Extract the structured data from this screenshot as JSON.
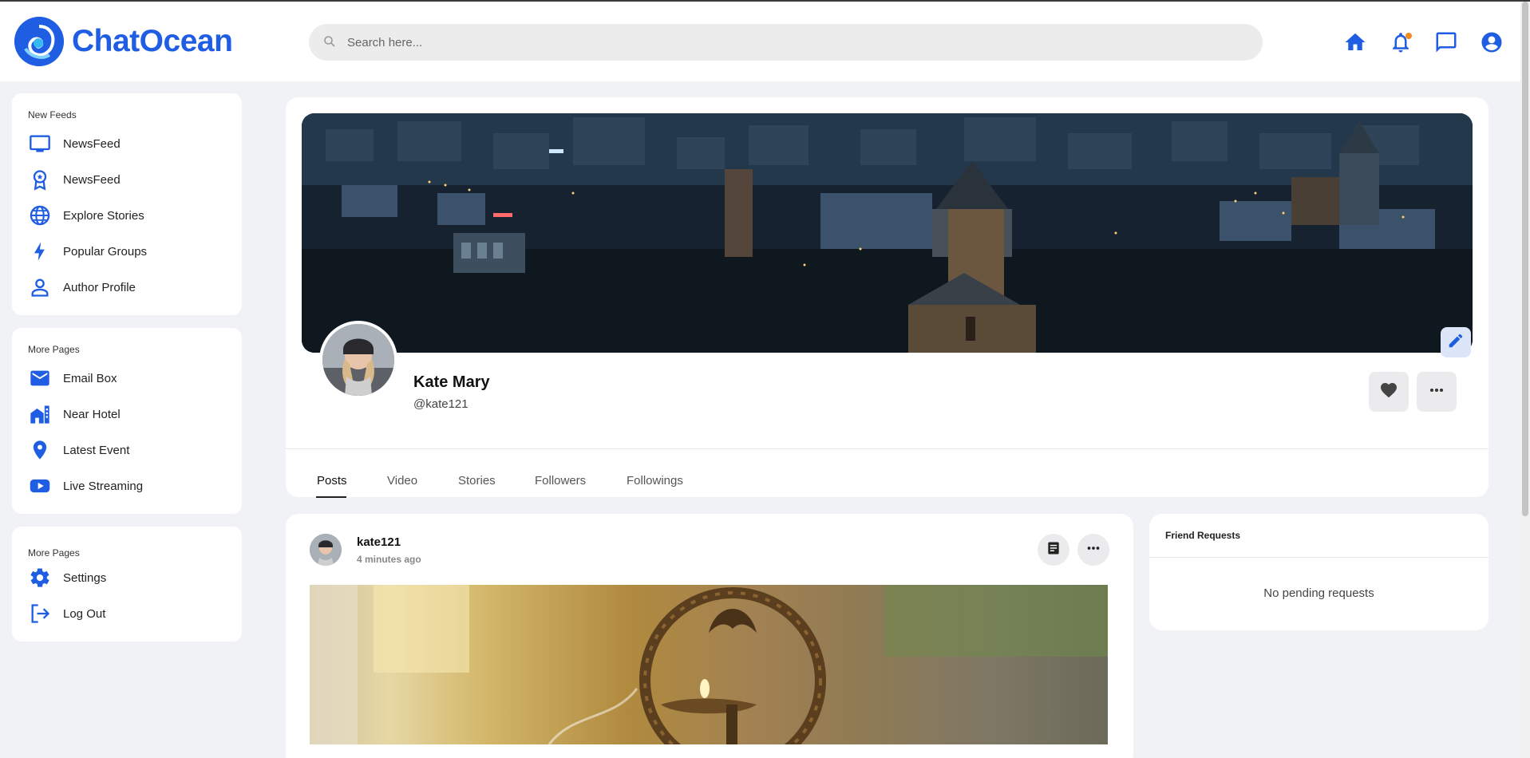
{
  "app": {
    "name": "ChatOcean"
  },
  "search": {
    "placeholder": "Search here..."
  },
  "header_icons": [
    "home-icon",
    "bell-icon",
    "chat-icon",
    "account-icon"
  ],
  "colors": {
    "accent": "#1f5de3",
    "notification_dot": "#f58a1f",
    "background": "#f1f2f5"
  },
  "sidebar": {
    "groups": [
      {
        "title": "New Feeds",
        "items": [
          {
            "label": "NewsFeed",
            "icon": "monitor-icon"
          },
          {
            "label": "NewsFeed",
            "icon": "badge-icon"
          },
          {
            "label": "Explore Stories",
            "icon": "globe-icon"
          },
          {
            "label": "Popular Groups",
            "icon": "lightning-icon"
          },
          {
            "label": "Author Profile",
            "icon": "user-icon"
          }
        ]
      },
      {
        "title": "More Pages",
        "items": [
          {
            "label": "Email Box",
            "icon": "mail-icon"
          },
          {
            "label": "Near Hotel",
            "icon": "hotel-icon"
          },
          {
            "label": "Latest Event",
            "icon": "location-pin-icon"
          },
          {
            "label": "Live Streaming",
            "icon": "youtube-icon"
          }
        ]
      },
      {
        "title": "More Pages",
        "items": [
          {
            "label": "Settings",
            "icon": "gear-icon"
          },
          {
            "label": "Log Out",
            "icon": "logout-icon"
          }
        ]
      }
    ]
  },
  "profile": {
    "name": "Kate Mary",
    "handle": "@kate121",
    "tabs": [
      {
        "label": "Posts",
        "active": true
      },
      {
        "label": "Video",
        "active": false
      },
      {
        "label": "Stories",
        "active": false
      },
      {
        "label": "Followers",
        "active": false
      },
      {
        "label": "Followings",
        "active": false
      }
    ]
  },
  "post": {
    "username": "kate121",
    "time": "4 minutes ago"
  },
  "friend_requests": {
    "title": "Friend Requests",
    "empty_text": "No pending requests"
  }
}
